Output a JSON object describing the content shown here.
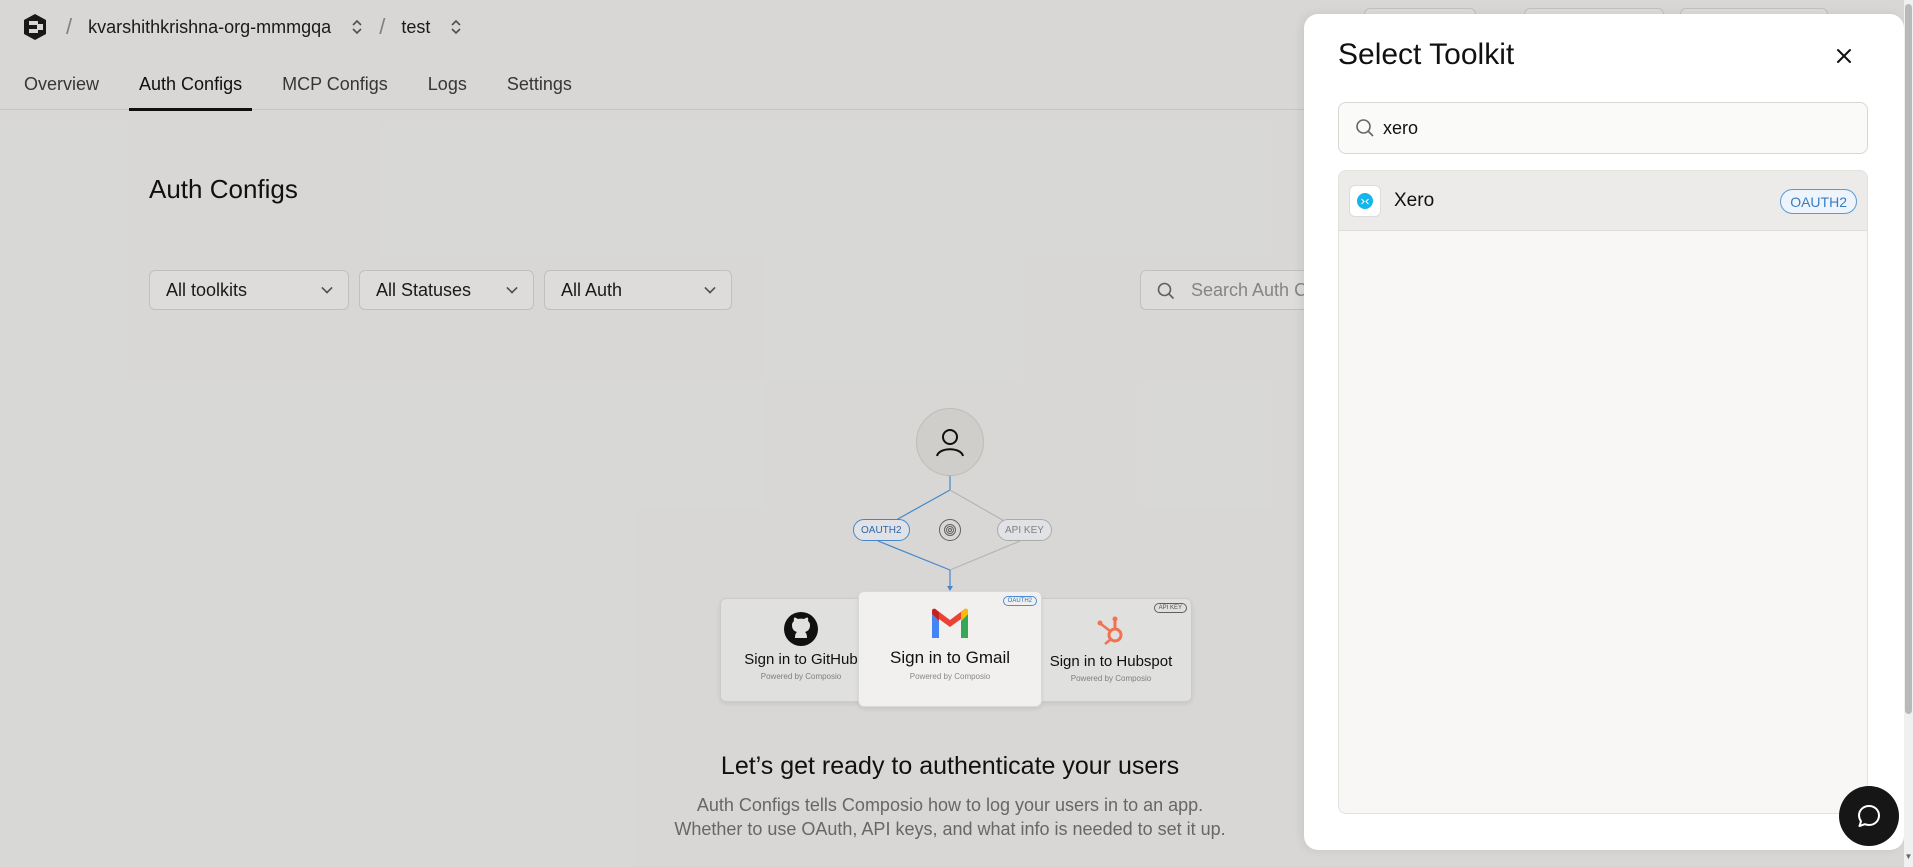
{
  "header": {
    "org_name": "kvarshithkrishna-org-mmmgqa",
    "project_name": "test",
    "separator": "/"
  },
  "tabs": [
    {
      "label": "Overview",
      "active": false
    },
    {
      "label": "Auth Configs",
      "active": true
    },
    {
      "label": "MCP Configs",
      "active": false
    },
    {
      "label": "Logs",
      "active": false
    },
    {
      "label": "Settings",
      "active": false
    }
  ],
  "main": {
    "title": "Auth Configs",
    "filters": {
      "toolkits": "All toolkits",
      "statuses": "All Statuses",
      "auth": "All Auth"
    },
    "search_placeholder": "Search Auth C",
    "illustration": {
      "oauth_label": "OAUTH2",
      "apikey_label": "API KEY",
      "cards": {
        "github": "Sign in to GitHub",
        "gmail": "Sign in to Gmail",
        "hubspot": "Sign in to Hubspot",
        "powered_by": "Powered by Composio",
        "gmail_badge": "OAUTH2",
        "hubspot_badge": "API KEY"
      }
    },
    "empty_title": "Let’s get ready to authenticate your users",
    "empty_desc_line1": "Auth Configs tells Composio how to log your users in to an app.",
    "empty_desc_line2": "Whether to use OAuth, API keys, and what info is needed to set it up."
  },
  "drawer": {
    "title": "Select Toolkit",
    "search_value": "xero",
    "results": [
      {
        "name": "Xero",
        "auth": "OAUTH2"
      }
    ]
  },
  "colors": {
    "background": "#e6e5e3",
    "drawer": "#ffffff",
    "oauth_blue": "#3a7cc0",
    "xero_blue": "#13b5ea"
  }
}
